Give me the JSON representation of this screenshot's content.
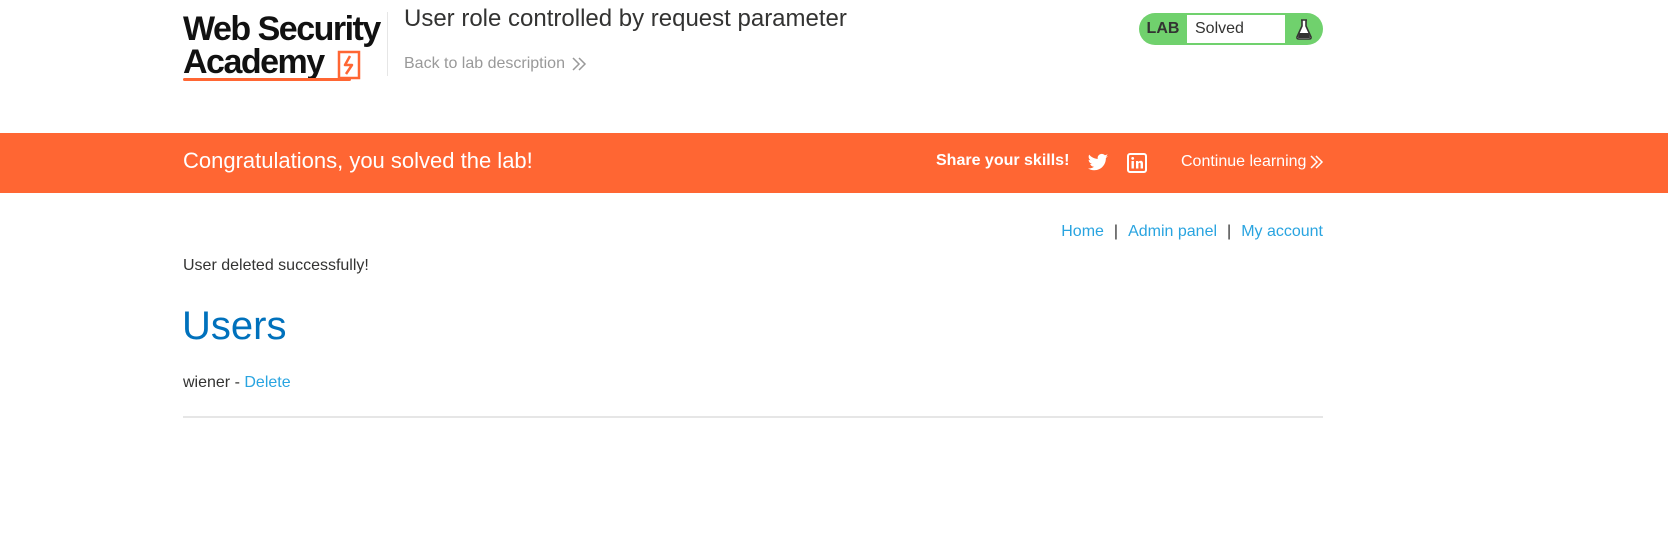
{
  "header": {
    "logo": {
      "line1": "Web Security",
      "line2": "Academy"
    },
    "lab_title": "User role controlled by request parameter",
    "back_link": "Back to lab description",
    "lab_status": {
      "label": "LAB",
      "value": "Solved",
      "icon": "flask-icon",
      "color": "#70d16d"
    }
  },
  "banner": {
    "message": "Congratulations, you solved the lab!",
    "share_label": "Share your skills!",
    "share_icons": [
      "twitter-icon",
      "linkedin-icon"
    ],
    "continue_label": "Continue learning",
    "color": "#ff6633"
  },
  "nav": {
    "items": [
      "Home",
      "Admin panel",
      "My account"
    ],
    "separator": "|"
  },
  "content": {
    "status_message": "User deleted successfully!",
    "heading": "Users",
    "users": [
      {
        "name": "wiener",
        "separator": " - ",
        "action": "Delete"
      }
    ]
  },
  "colors": {
    "link": "#29a4e0",
    "heading": "#0071bc",
    "accent": "#ff6633"
  }
}
